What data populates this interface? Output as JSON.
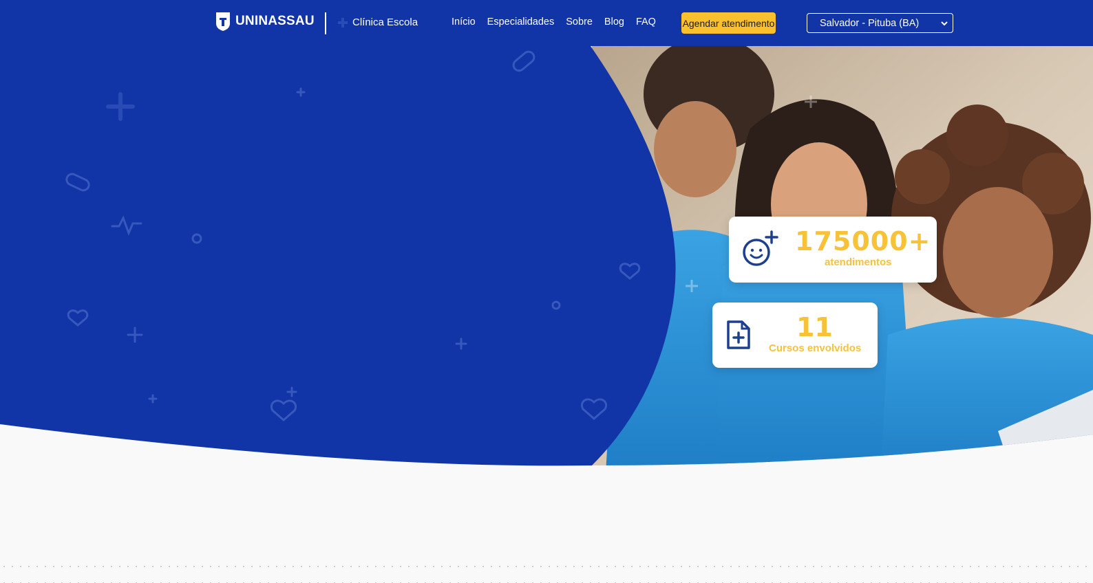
{
  "header": {
    "logo_text": "UNINASSAU",
    "clinic_label": "Clínica Escola",
    "nav": [
      "Início",
      "Especialidades",
      "Sobre",
      "Blog",
      "FAQ"
    ],
    "cta_label": "Agendar atendimento",
    "location_select": "Salvador - Pituba (BA)"
  },
  "stats": [
    {
      "value": "175000+",
      "label": "atendimentos",
      "icon": "smiley-plus-icon"
    },
    {
      "value": "11",
      "label": "Cursos envolvidos",
      "icon": "medical-file-icon"
    }
  ],
  "colors": {
    "brand_blue": "#1134a6",
    "accent_yellow": "#fbc02d",
    "stat_yellow": "#f7c238",
    "background": "#f9f9fa"
  }
}
